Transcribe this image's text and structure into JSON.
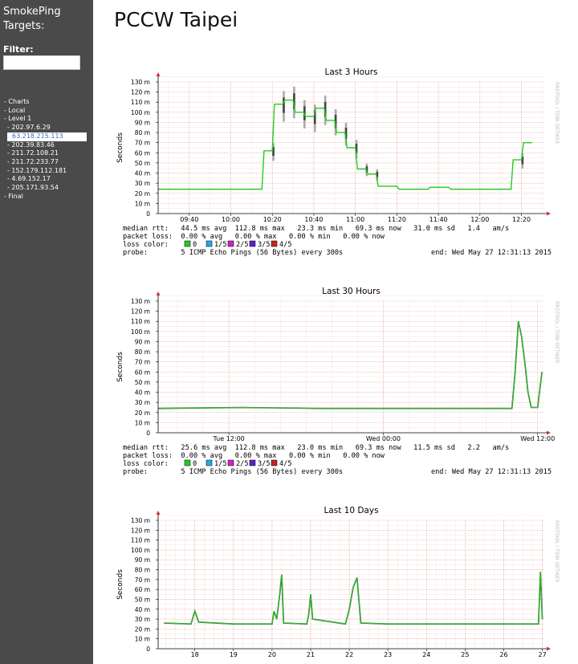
{
  "sidebar": {
    "title_line1": "SmokePing",
    "title_line2": "Targets:",
    "filter_label": "Filter:",
    "filter_value": "",
    "items": [
      {
        "label": "- Charts",
        "level": 0,
        "selected": false
      },
      {
        "label": "- Local",
        "level": 0,
        "selected": false
      },
      {
        "label": "- Level 1",
        "level": 0,
        "selected": false
      },
      {
        "label": "- 202.97.6.29",
        "level": 1,
        "selected": false
      },
      {
        "label": "63.218.215.113",
        "level": 1,
        "selected": true
      },
      {
        "label": "- 202.39.83.46",
        "level": 1,
        "selected": false
      },
      {
        "label": "- 211.72.108.21",
        "level": 1,
        "selected": false
      },
      {
        "label": "- 211.72.233.77",
        "level": 1,
        "selected": false
      },
      {
        "label": "- 152.179.112.181",
        "level": 1,
        "selected": false
      },
      {
        "label": "- 4.69.152.17",
        "level": 1,
        "selected": false
      },
      {
        "label": "- 205.171.93.54",
        "level": 1,
        "selected": false
      },
      {
        "label": "- Final",
        "level": 0,
        "selected": false
      }
    ]
  },
  "page_title": "PCCW Taipei",
  "watermark": "RRDTOOL / TOBI OETIKER",
  "colors": {
    "sidebar_bg": "#4a4a4a",
    "grid_minor": "#f3c4c4",
    "grid_major": "#e89898",
    "median_line": "#22cc22",
    "smoke_dark": "#444444",
    "smoke_light": "#aaaaaa",
    "loss_0": "#22cc22",
    "loss_1": "#22aaee",
    "loss_2": "#cc22cc",
    "loss_3": "#5522cc",
    "loss_4": "#cc2222"
  },
  "chart_data": [
    {
      "type": "area",
      "title": "Last 3 Hours",
      "ylabel": "Seconds",
      "ylim": [
        0,
        130
      ],
      "y_unit": "m",
      "x_ticks": [
        "09:40",
        "10:00",
        "10:20",
        "10:40",
        "11:00",
        "11:20",
        "11:40",
        "12:00",
        "12:20"
      ],
      "median_rtt": [
        {
          "time": "09:25",
          "value": 24
        },
        {
          "time": "10:10",
          "value": 24
        },
        {
          "time": "10:15",
          "value": 24
        },
        {
          "time": "10:16",
          "value": 62
        },
        {
          "time": "10:20",
          "value": 62
        },
        {
          "time": "10:21",
          "value": 108
        },
        {
          "time": "10:25",
          "value": 108
        },
        {
          "time": "10:26",
          "value": 112
        },
        {
          "time": "10:30",
          "value": 112
        },
        {
          "time": "10:31",
          "value": 100
        },
        {
          "time": "10:35",
          "value": 100
        },
        {
          "time": "10:36",
          "value": 96
        },
        {
          "time": "10:40",
          "value": 96
        },
        {
          "time": "10:41",
          "value": 104
        },
        {
          "time": "10:45",
          "value": 104
        },
        {
          "time": "10:46",
          "value": 92
        },
        {
          "time": "10:50",
          "value": 92
        },
        {
          "time": "10:51",
          "value": 80
        },
        {
          "time": "10:55",
          "value": 80
        },
        {
          "time": "10:56",
          "value": 65
        },
        {
          "time": "11:00",
          "value": 65
        },
        {
          "time": "11:01",
          "value": 44
        },
        {
          "time": "11:05",
          "value": 44
        },
        {
          "time": "11:06",
          "value": 39
        },
        {
          "time": "11:10",
          "value": 39
        },
        {
          "time": "11:11",
          "value": 27
        },
        {
          "time": "11:20",
          "value": 27
        },
        {
          "time": "11:21",
          "value": 24
        },
        {
          "time": "11:35",
          "value": 24
        },
        {
          "time": "11:36",
          "value": 26
        },
        {
          "time": "11:45",
          "value": 26
        },
        {
          "time": "11:46",
          "value": 24
        },
        {
          "time": "12:15",
          "value": 24
        },
        {
          "time": "12:16",
          "value": 53
        },
        {
          "time": "12:20",
          "value": 53
        },
        {
          "time": "12:21",
          "value": 70
        },
        {
          "time": "12:25",
          "value": 70
        }
      ],
      "legend": {
        "median_rtt": "median rtt:   44.5 ms avg  112.8 ms max   23.3 ms min   69.3 ms now   31.0 ms sd   1.4   am/s",
        "packet_loss": "packet loss:  0.00 % avg   0.00 % max   0.00 % min   0.00 % now",
        "loss_color_label": "loss color:",
        "loss_items": [
          "0",
          "1/5",
          "2/5",
          "3/5",
          "4/5"
        ],
        "probe": "probe:        5 ICMP Echo Pings (56 Bytes) every 300s",
        "end": "end: Wed May 27 12:31:13 2015"
      }
    },
    {
      "type": "area",
      "title": "Last 30 Hours",
      "ylabel": "Seconds",
      "ylim": [
        0,
        130
      ],
      "y_unit": "m",
      "x_ticks": [
        "Tue 12:00",
        "Wed 00:00",
        "Wed 12:00"
      ],
      "median_rtt": [
        {
          "time": "Tue 06:30",
          "value": 24
        },
        {
          "time": "Tue 13:00",
          "value": 25
        },
        {
          "time": "Tue 19:00",
          "value": 24
        },
        {
          "time": "Wed 00:00",
          "value": 24
        },
        {
          "time": "Wed 06:00",
          "value": 24
        },
        {
          "time": "Wed 10:00",
          "value": 24
        },
        {
          "time": "Wed 10:15",
          "value": 60
        },
        {
          "time": "Wed 10:30",
          "value": 110
        },
        {
          "time": "Wed 10:45",
          "value": 95
        },
        {
          "time": "Wed 11:00",
          "value": 70
        },
        {
          "time": "Wed 11:15",
          "value": 40
        },
        {
          "time": "Wed 11:30",
          "value": 25
        },
        {
          "time": "Wed 12:00",
          "value": 25
        },
        {
          "time": "Wed 12:20",
          "value": 60
        }
      ],
      "legend": {
        "median_rtt": "median rtt:   25.6 ms avg  112.8 ms max   23.0 ms min   69.3 ms now   11.5 ms sd   2.2   am/s",
        "packet_loss": "packet loss:  0.00 % avg   0.00 % max   0.00 % min   0.00 % now",
        "loss_color_label": "loss color:",
        "loss_items": [
          "0",
          "1/5",
          "2/5",
          "3/5",
          "4/5"
        ],
        "probe": "probe:        5 ICMP Echo Pings (56 Bytes) every 300s",
        "end": "end: Wed May 27 12:31:13 2015"
      }
    },
    {
      "type": "area",
      "title": "Last 10 Days",
      "ylabel": "Seconds",
      "ylim": [
        0,
        130
      ],
      "y_unit": "m",
      "x_ticks": [
        "18",
        "19",
        "20",
        "21",
        "22",
        "23",
        "24",
        "25",
        "26",
        "27"
      ],
      "median_rtt": [
        {
          "day": 17.2,
          "value": 26
        },
        {
          "day": 17.9,
          "value": 25
        },
        {
          "day": 18.0,
          "value": 38
        },
        {
          "day": 18.1,
          "value": 27
        },
        {
          "day": 19.0,
          "value": 25
        },
        {
          "day": 20.0,
          "value": 25
        },
        {
          "day": 20.05,
          "value": 38
        },
        {
          "day": 20.12,
          "value": 30
        },
        {
          "day": 20.2,
          "value": 55
        },
        {
          "day": 20.25,
          "value": 75
        },
        {
          "day": 20.3,
          "value": 26
        },
        {
          "day": 20.9,
          "value": 25
        },
        {
          "day": 20.95,
          "value": 35
        },
        {
          "day": 21.0,
          "value": 55
        },
        {
          "day": 21.05,
          "value": 30
        },
        {
          "day": 21.9,
          "value": 25
        },
        {
          "day": 22.0,
          "value": 40
        },
        {
          "day": 22.1,
          "value": 62
        },
        {
          "day": 22.2,
          "value": 72
        },
        {
          "day": 22.3,
          "value": 26
        },
        {
          "day": 23.0,
          "value": 25
        },
        {
          "day": 24.0,
          "value": 25
        },
        {
          "day": 25.0,
          "value": 25
        },
        {
          "day": 26.0,
          "value": 25
        },
        {
          "day": 26.9,
          "value": 25
        },
        {
          "day": 26.95,
          "value": 78
        },
        {
          "day": 27.0,
          "value": 30
        }
      ],
      "legend": null
    }
  ]
}
